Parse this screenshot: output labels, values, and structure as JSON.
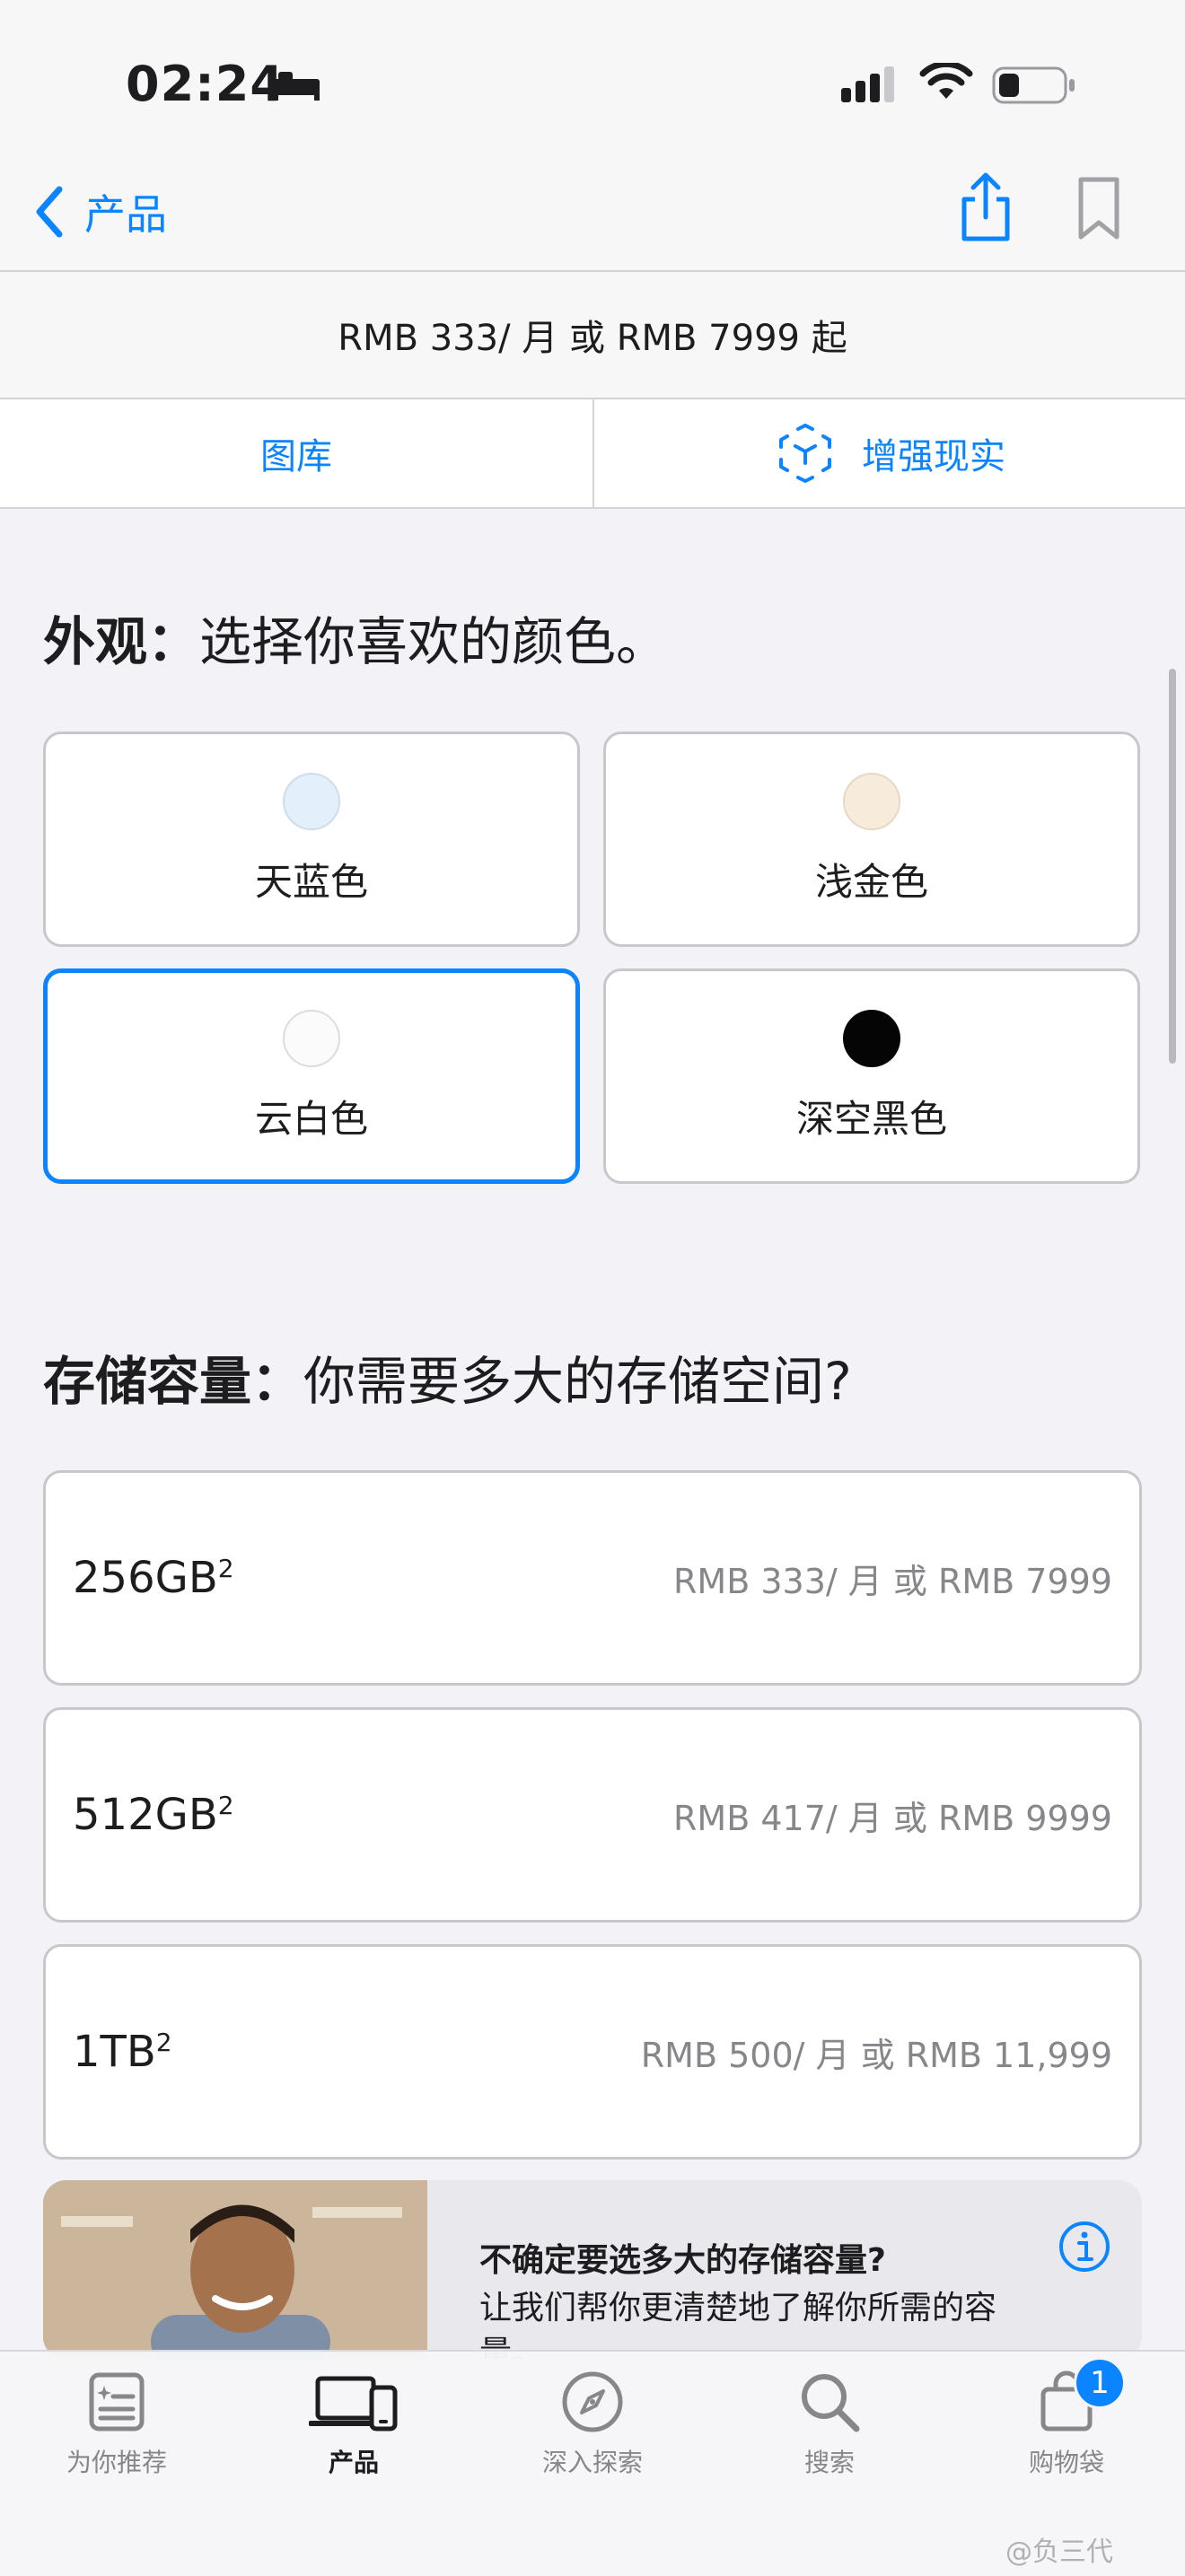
{
  "status": {
    "time": "02:24"
  },
  "nav": {
    "back_label": "产品"
  },
  "price_summary": "RMB 333/ 月 或 RMB 7999 起",
  "view_tabs": [
    {
      "label": "图库"
    },
    {
      "label": "增强现实"
    }
  ],
  "appearance": {
    "title_bold": "外观：",
    "title_rest": "选择你喜欢的颜色。",
    "options": [
      {
        "label": "天蓝色",
        "swatch": "#e3effb",
        "selected": false
      },
      {
        "label": "浅金色",
        "swatch": "#f7ecdc",
        "selected": false
      },
      {
        "label": "云白色",
        "swatch": "#fbfbfb",
        "selected": true
      },
      {
        "label": "深空黑色",
        "swatch": "#050505",
        "selected": false
      }
    ]
  },
  "storage": {
    "title_bold": "存储容量：",
    "title_rest": "你需要多大的存储空间?",
    "options": [
      {
        "capacity": "256GB",
        "footnote": "2",
        "price": "RMB 333/ 月 或 RMB 7999"
      },
      {
        "capacity": "512GB",
        "footnote": "2",
        "price": "RMB 417/ 月 或 RMB 9999"
      },
      {
        "capacity": "1TB",
        "footnote": "2",
        "price": "RMB 500/ 月 或 RMB 11,999"
      }
    ]
  },
  "help_promo": {
    "title": "不确定要选多大的存储容量?",
    "body": "让我们帮你更清楚地了解你所需的容量。"
  },
  "tab_bar": {
    "items": [
      {
        "label": "为你推荐",
        "icon": "for-you-icon"
      },
      {
        "label": "产品",
        "icon": "devices-icon",
        "active": true
      },
      {
        "label": "深入探索",
        "icon": "compass-icon"
      },
      {
        "label": "搜索",
        "icon": "search-icon"
      },
      {
        "label": "购物袋",
        "icon": "bag-icon"
      }
    ],
    "bag_badge": "1"
  },
  "watermark": "@负三代",
  "colors": {
    "accent": "#0a84ff",
    "page_bg": "#f2f2f7"
  }
}
